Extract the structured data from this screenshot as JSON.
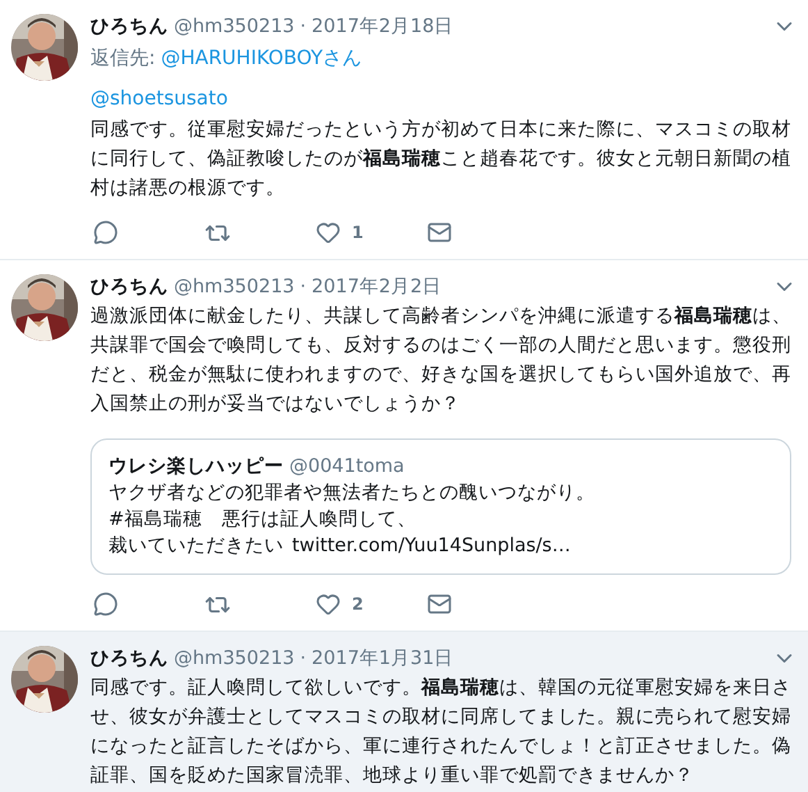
{
  "tweets": [
    {
      "name": "ひろちん",
      "handle": "@hm350213",
      "separator": "·",
      "date": "2017年2月18日",
      "highlighted": false,
      "reply_to": {
        "label": "返信先:",
        "target": "@HARUHIKOBOYさん"
      },
      "mentions": [
        "@shoetsusato"
      ],
      "text": "同感です。従軍慰安婦だったという方が初めて日本に来た際に、マスコミの取材に同行して、偽証教唆したのが**福島瑞穂**こと趙春花です。彼女と元朝日新聞の植村は諸悪の根源です。",
      "actions": {
        "like_count": "1"
      }
    },
    {
      "name": "ひろちん",
      "handle": "@hm350213",
      "separator": "·",
      "date": "2017年2月2日",
      "highlighted": false,
      "text": "過激派団体に献金したり、共謀して高齢者シンパを沖縄に派遣する**福島瑞穂**は、共謀罪で国会で喚問しても、反対するのはごく一部の人間だと思います。懲役刑だと、税金が無駄に使われますので、好きな国を選択してもらい国外追放で、再入国禁止の刑が妥当ではないでしょうか？",
      "quote": {
        "name": "ウレシ楽しハッピー",
        "handle": "@0041toma",
        "lines": [
          "ヤクザ者などの犯罪者や無法者たちとの醜いつながり。",
          "#福島瑞穂　悪行は証人喚問して、"
        ],
        "last_line": "裁いていただきたい",
        "link": "twitter.com/Yuu14Sunplas/s…"
      },
      "actions": {
        "like_count": "2"
      }
    },
    {
      "name": "ひろちん",
      "handle": "@hm350213",
      "separator": "·",
      "date": "2017年1月31日",
      "highlighted": true,
      "text": "同感です。証人喚問して欲しいです。**福島瑞穂**は、韓国の元従軍慰安婦を来日させ、彼女が弁護士としてマスコミの取材に同席してました。親に売られて慰安婦になったと証言したそばから、軍に連行されたんでしょ！と訂正させました。偽証罪、国を貶めた国家冒涜罪、地球より重い罪で処罰できませんか？"
    }
  ]
}
